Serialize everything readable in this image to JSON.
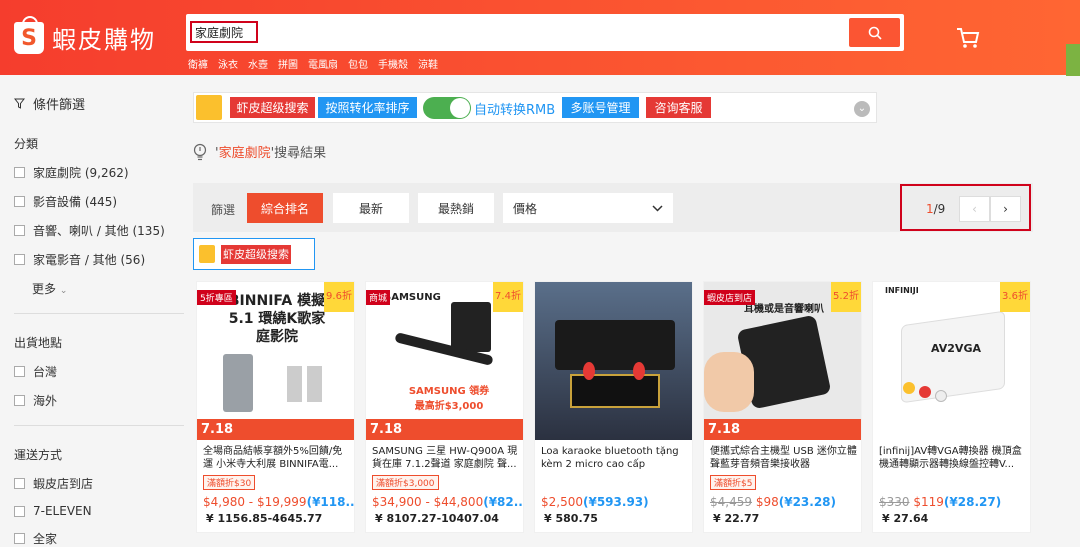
{
  "header": {
    "brand": "蝦皮購物",
    "logo_letter": "S",
    "search": {
      "value": "家庭劇院"
    },
    "hints": [
      "衛褲",
      "泳衣",
      "水壺",
      "拼圖",
      "電風扇",
      "包包",
      "手機殼",
      "涼鞋"
    ]
  },
  "sidebar": {
    "title": "條件篩選",
    "category": {
      "heading": "分類",
      "items": [
        {
          "label": "家庭劇院 (9,262)"
        },
        {
          "label": "影音設備 (445)"
        },
        {
          "label": "音響、喇叭 / 其他 (135)"
        },
        {
          "label": "家電影音 / 其他 (56)"
        }
      ],
      "more": "更多"
    },
    "shipfrom": {
      "heading": "出貨地點",
      "items": [
        "台灣",
        "海外"
      ]
    },
    "shipping": {
      "heading": "運送方式",
      "items": [
        "蝦皮店到店",
        "7-ELEVEN",
        "全家"
      ]
    }
  },
  "toolbar": {
    "btn1": "虾皮超级搜索",
    "btn2": "按照转化率排序",
    "toggle_label": "自动转换RMB",
    "btn3": "多账号管理",
    "btn4": "咨询客服"
  },
  "result": {
    "prefix": "'",
    "keyword": "家庭劇院",
    "suffix": "'搜尋結果"
  },
  "sort": {
    "label": "篩選",
    "tabs": [
      "綜合排名",
      "最新",
      "最熱銷"
    ],
    "price": "價格",
    "page_current": "1",
    "page_total": "/9"
  },
  "super_button": "虾皮超级搜索",
  "products": [
    {
      "tag": "5折專區",
      "discount": "9.6折",
      "promo": "7.18",
      "name": "全場商品結帳享額外5%回饋/免運 小米寺大利展 BINNIFA電...",
      "badge": "滿額折$30",
      "price": "$4,980 - $19,999",
      "conv": "(¥118...",
      "rmb": "¥ 1156.85-4645.77",
      "img": "BINNIFA 模擬5.1 環繞K歌家庭影院"
    },
    {
      "tag": "商城",
      "discount": "7.4折",
      "promo": "7.18",
      "name": "SAMSUNG 三星 HW-Q900A 現貨在庫 7.1.2聲道 家庭劇院 聲...",
      "badge": "滿額折$3,000",
      "price": "$34,900 - $44,800",
      "conv": "(¥82...",
      "rmb": "¥ 8107.27-10407.04",
      "img": "SAMSUNG 領券最高折$3,000"
    },
    {
      "tag": "",
      "discount": "",
      "promo": "",
      "name": "Loa karaoke bluetooth tặng kèm 2 micro cao cấp",
      "badge": "",
      "price": "$2,500",
      "conv": "(¥593.93)",
      "rmb": "¥ 580.75",
      "img": ""
    },
    {
      "tag": "蝦皮店到店",
      "discount": "5.2折",
      "promo": "7.18",
      "name": "便攜式綜合主機型 USB 迷你立體聲藍芽音頻音樂接收器",
      "badge": "滿額折$5",
      "price_orig": "$4,459",
      "price": "$98",
      "conv": "(¥23.28)",
      "rmb": "¥ 22.77",
      "img": "耳機或是音響喇叭"
    },
    {
      "tag": "INFINIJI",
      "discount": "3.6折",
      "promo": "",
      "name": "[infinij]AV轉VGA轉換器 機頂盒 機通轉顯示器轉換線盤控轉V...",
      "badge": "",
      "price_orig": "$330",
      "price": "$119",
      "conv": "(¥28.27)",
      "rmb": "¥ 27.64",
      "img": "AV2VGA"
    }
  ],
  "colors": {
    "brand": "#ee4d2d",
    "accent_blue": "#2196f3",
    "toggle_green": "#4caf50"
  }
}
